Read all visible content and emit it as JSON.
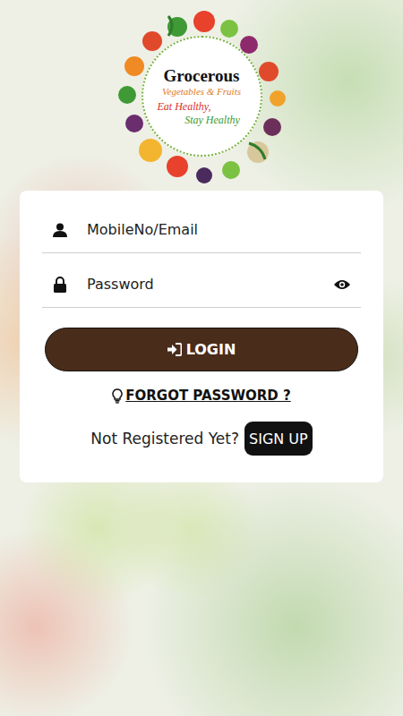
{
  "logo": {
    "title": "Grocerous",
    "subtitle": "Vegetables & Fruits",
    "tagline": [
      "Eat Healthy,",
      "Stay Healthy"
    ]
  },
  "form": {
    "username": {
      "placeholder": "MobileNo/Email"
    },
    "password": {
      "placeholder": "Password",
      "visible": false
    }
  },
  "login_button": {
    "label": "LOGIN"
  },
  "forgot_password": {
    "label": "FORGOT PASSWORD ?"
  },
  "signup": {
    "prompt": "Not Registered Yet?",
    "button": "SIGN UP"
  }
}
